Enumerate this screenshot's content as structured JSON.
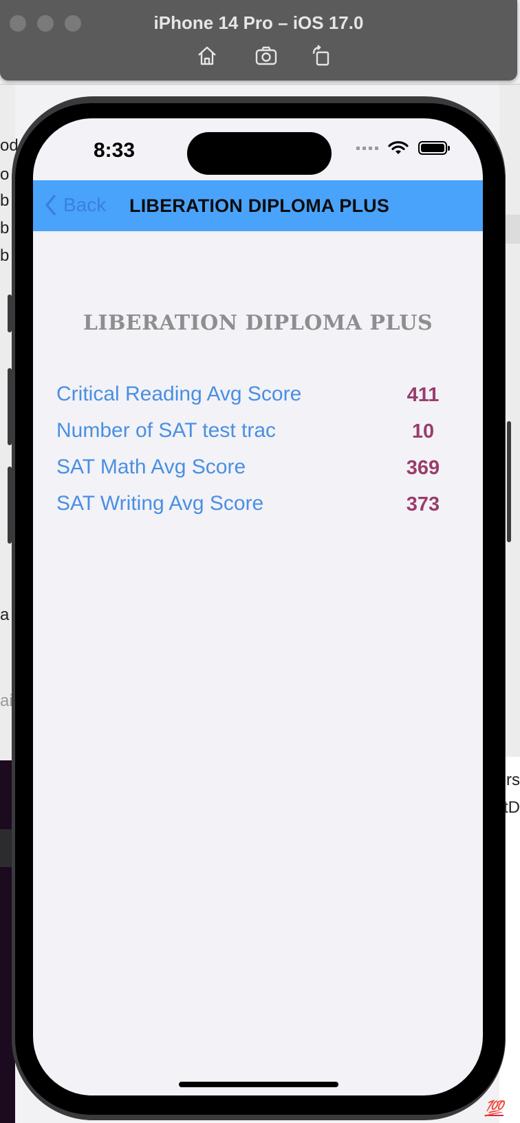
{
  "simulator": {
    "title": "iPhone 14 Pro – iOS 17.0",
    "toolbar": [
      {
        "icon": "home-icon"
      },
      {
        "icon": "screenshot-icon"
      },
      {
        "icon": "rotate-icon"
      }
    ]
  },
  "background": {
    "left_fragments": [
      "od",
      "o",
      "b",
      "b",
      "b",
      "a",
      "ai"
    ],
    "right_fragments": [
      "rs",
      "ftD"
    ],
    "emoji": "💯"
  },
  "status_bar": {
    "time": "8:33",
    "icons": [
      "cellular-signal-icon",
      "wifi-icon",
      "battery-icon"
    ]
  },
  "nav": {
    "back_label": "Back",
    "title": "LIBERATION DIPLOMA PLUS",
    "background_color": "#4aa3fb"
  },
  "school": {
    "name": "LIBERATION DIPLOMA PLUS"
  },
  "scores": [
    {
      "label": "Critical Reading Avg Score",
      "value": "411"
    },
    {
      "label": "Number of SAT test trac",
      "value": "10"
    },
    {
      "label": "SAT Math Avg Score",
      "value": "369"
    },
    {
      "label": "SAT Writing Avg Score",
      "value": "373"
    }
  ],
  "colors": {
    "label": "#4a8fe2",
    "value": "#9a3c6c",
    "heading": "#8e8e8e"
  }
}
